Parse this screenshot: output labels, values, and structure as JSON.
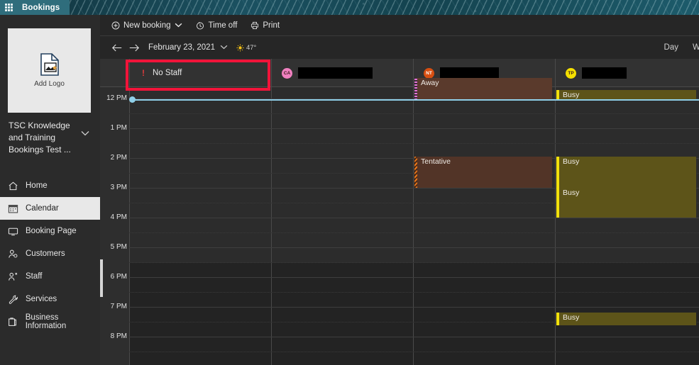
{
  "suite": {
    "app_name": "Bookings",
    "waffle_icon": "waffle-menu-icon"
  },
  "sidebar": {
    "logo": {
      "label": "Add Logo",
      "icon": "image-file-icon"
    },
    "org_name": "TSC Knowledge and Training Bookings Test ...",
    "org_chevron": "chevron-down-icon",
    "items": [
      {
        "label": "Home",
        "icon": "home-icon",
        "selected": false
      },
      {
        "label": "Calendar",
        "icon": "calendar-icon",
        "selected": true
      },
      {
        "label": "Booking Page",
        "icon": "monitor-icon",
        "selected": false
      },
      {
        "label": "Customers",
        "icon": "customers-icon",
        "selected": false
      },
      {
        "label": "Staff",
        "icon": "staff-icon",
        "selected": false
      },
      {
        "label": "Services",
        "icon": "wrench-icon",
        "selected": false
      },
      {
        "label": "Business Information",
        "icon": "briefcase-icon",
        "selected": false
      }
    ]
  },
  "toolbar": {
    "new_booking": {
      "label": "New booking",
      "icon": "plus-circle-icon",
      "caret": "❯"
    },
    "time_off": {
      "label": "Time off",
      "icon": "clock-icon"
    },
    "print": {
      "label": "Print",
      "icon": "printer-icon"
    }
  },
  "datebar": {
    "prev_icon": "arrow-left-icon",
    "next_icon": "arrow-right-icon",
    "date": "February 23, 2021",
    "date_caret": "❯",
    "weather_icon": "sun-icon",
    "temperature": "47°"
  },
  "views": {
    "day": "Day",
    "week_partial": "W"
  },
  "calendar": {
    "columns": [
      {
        "name": "No Staff",
        "initials": "",
        "avatar_color": "",
        "warning_icon": "alert-icon",
        "redacted": false,
        "highlighted": true
      },
      {
        "name": "",
        "initials": "CA",
        "avatar_color": "#f080c0",
        "warning_icon": "",
        "redacted": true,
        "highlighted": false
      },
      {
        "name": "",
        "initials": "NT",
        "avatar_color": "#d94f11",
        "warning_icon": "",
        "redacted": true,
        "highlighted": false
      },
      {
        "name": "",
        "initials": "TP",
        "avatar_color": "#f5e000",
        "warning_icon": "",
        "redacted": true,
        "highlighted": false
      }
    ],
    "time_labels": [
      "12 PM",
      "1 PM",
      "2 PM",
      "3 PM",
      "4 PM",
      "5 PM",
      "6 PM",
      "7 PM",
      "8 PM"
    ],
    "events": [
      {
        "column": 2,
        "label": "Away",
        "type": "away",
        "start_hour": 11.3,
        "end_hour": 12.05
      },
      {
        "column": 3,
        "label": "Busy",
        "type": "busy",
        "start_hour": 11.72,
        "end_hour": 12.02
      },
      {
        "column": 2,
        "label": "Tentative",
        "type": "tent",
        "start_hour": 13.95,
        "end_hour": 15.0
      },
      {
        "column": 3,
        "label": "Busy",
        "type": "busy",
        "start_hour": 13.95,
        "end_hour": 15.0
      },
      {
        "column": 3,
        "label": "Busy",
        "type": "busy",
        "start_hour": 15.0,
        "end_hour": 16.0
      },
      {
        "column": 3,
        "label": "Busy",
        "type": "busy",
        "start_hour": 19.2,
        "end_hour": 19.62
      }
    ],
    "now_indicator": {
      "hour": 12.02,
      "color": "#8fcfe8"
    },
    "accent_highlight_color": "#f1143a"
  }
}
